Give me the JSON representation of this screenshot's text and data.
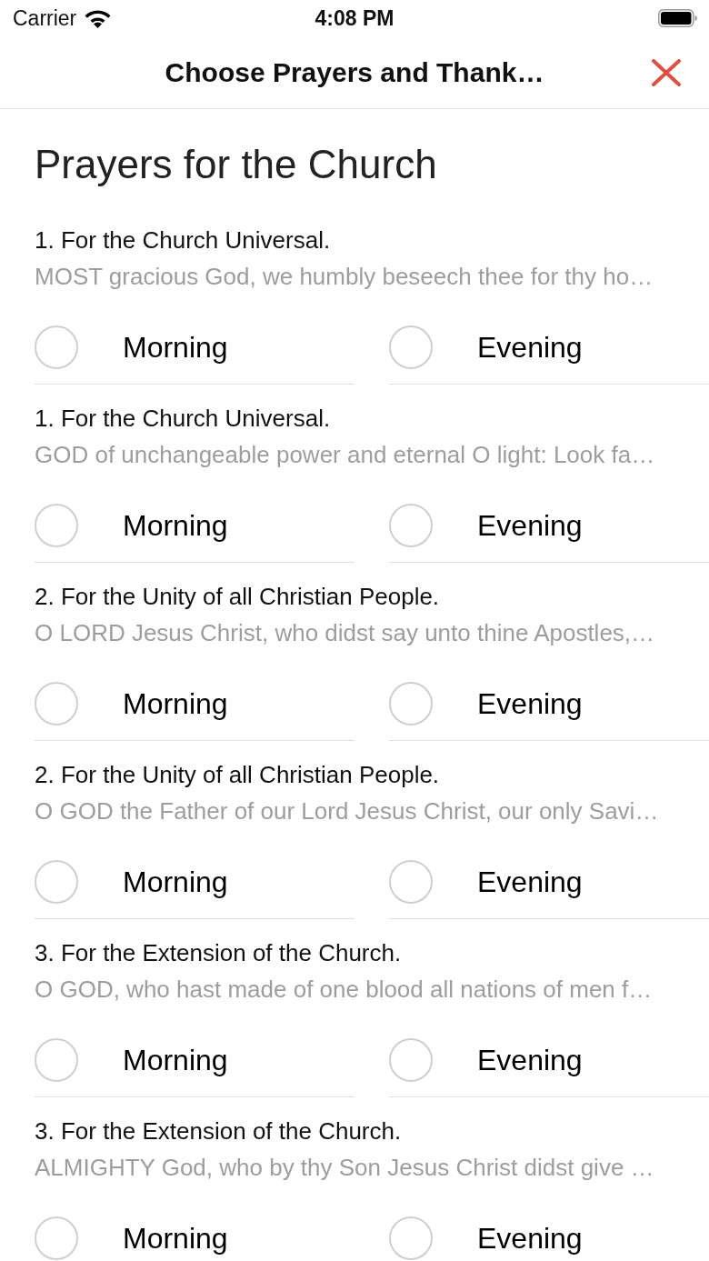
{
  "status_bar": {
    "carrier": "Carrier",
    "time": "4:08 PM"
  },
  "nav": {
    "title": "Choose Prayers and Thank…"
  },
  "section": {
    "title": "Prayers for the Church"
  },
  "prayers": [
    {
      "title": "1. For the Church Universal.",
      "preview": "MOST gracious God, we humbly beseech thee for thy ho…",
      "options": [
        {
          "label": "Morning",
          "checked": false
        },
        {
          "label": "Evening",
          "checked": false
        }
      ]
    },
    {
      "title": "1. For the Church Universal.",
      "preview": "GOD of unchangeable power and eternal O light: Look fa…",
      "options": [
        {
          "label": "Morning",
          "checked": false
        },
        {
          "label": "Evening",
          "checked": false
        }
      ]
    },
    {
      "title": "2. For the Unity of all Christian People.",
      "preview": "O LORD Jesus Christ, who didst say unto thine Apostles,…",
      "options": [
        {
          "label": "Morning",
          "checked": false
        },
        {
          "label": "Evening",
          "checked": false
        }
      ]
    },
    {
      "title": "2. For the Unity of all Christian People.",
      "preview": "O GOD the Father of our Lord Jesus Christ, our only Savi…",
      "options": [
        {
          "label": "Morning",
          "checked": false
        },
        {
          "label": "Evening",
          "checked": false
        }
      ]
    },
    {
      "title": "3. For the Extension of the Church.",
      "preview": "O GOD, who hast made of one blood all nations of men f…",
      "options": [
        {
          "label": "Morning",
          "checked": false
        },
        {
          "label": "Evening",
          "checked": false
        }
      ]
    },
    {
      "title": "3. For the Extension of the Church.",
      "preview": "ALMIGHTY God, who by thy Son Jesus Christ didst give …",
      "options": [
        {
          "label": "Morning",
          "checked": false
        },
        {
          "label": "Evening",
          "checked": false
        }
      ]
    }
  ]
}
